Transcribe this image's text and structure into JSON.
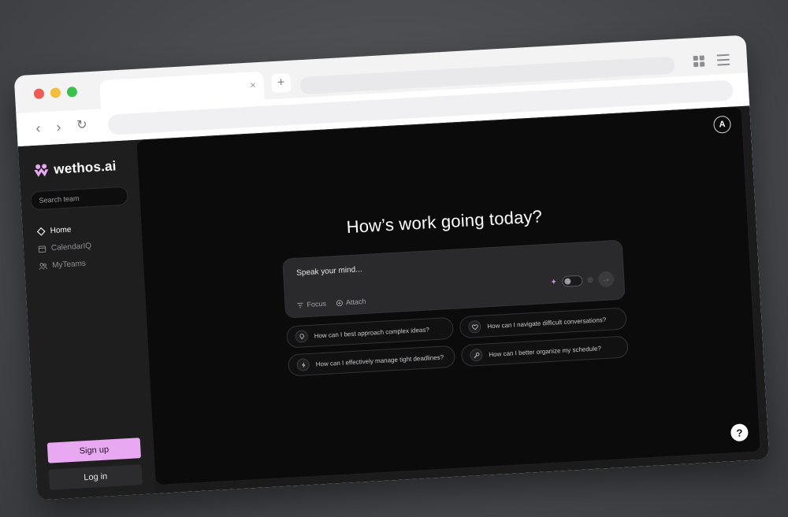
{
  "browser": {
    "tab_close_glyph": "×",
    "new_tab_glyph": "+",
    "back_glyph": "‹",
    "forward_glyph": "›",
    "reload_glyph": "↻"
  },
  "sidebar": {
    "brand": "wethos.ai",
    "search_placeholder": "Search team",
    "items": [
      {
        "label": "Home",
        "icon": "diamond-icon",
        "active": true
      },
      {
        "label": "CalendarIQ",
        "icon": "calendar-icon",
        "active": false
      },
      {
        "label": "MyTeams",
        "icon": "team-icon",
        "active": false
      }
    ],
    "signup_label": "Sign up",
    "login_label": "Log in"
  },
  "main": {
    "avatar_initial": "A",
    "headline": "How’s work going today?",
    "composer": {
      "placeholder": "Speak your mind...",
      "focus_label": "Focus",
      "attach_label": "Attach"
    },
    "suggestions": [
      {
        "label": "How can I best approach complex ideas?",
        "icon": "bulb-icon"
      },
      {
        "label": "How can I navigate difficult conversations?",
        "icon": "heart-icon"
      },
      {
        "label": "How can I effectively manage tight deadlines?",
        "icon": "lightning-icon"
      },
      {
        "label": "How can I better organize my schedule?",
        "icon": "wrench-icon"
      }
    ],
    "help_glyph": "?"
  },
  "colors": {
    "accent": "#e8a8f2",
    "background": "#0b0b0c",
    "sidebar": "#1e1e1f"
  }
}
